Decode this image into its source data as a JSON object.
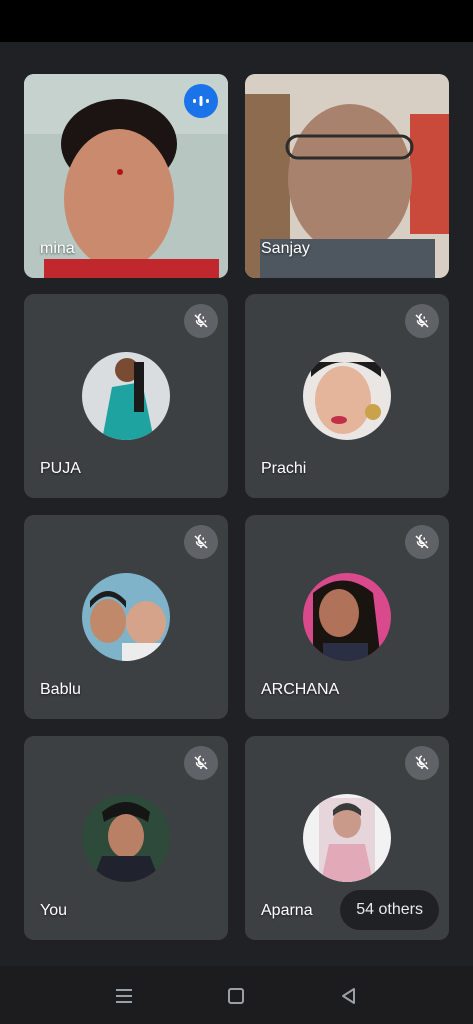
{
  "participants": [
    {
      "name": "mina"
    },
    {
      "name": "Sanjay"
    },
    {
      "name": "PUJA"
    },
    {
      "name": "Prachi"
    },
    {
      "name": "Bablu"
    },
    {
      "name": "ARCHANA"
    },
    {
      "name": "You"
    },
    {
      "name": "Aparna"
    }
  ],
  "others_label": "54 others",
  "icons": {
    "speaking": "audio-level-icon",
    "muted": "mic-off-icon",
    "nav_menu": "recent-apps-icon",
    "nav_home": "home-icon",
    "nav_back": "back-icon"
  },
  "colors": {
    "background": "#202124",
    "tile": "#3c4043",
    "speaking_badge": "#1a73e8",
    "muted_badge": "#5f6368"
  }
}
